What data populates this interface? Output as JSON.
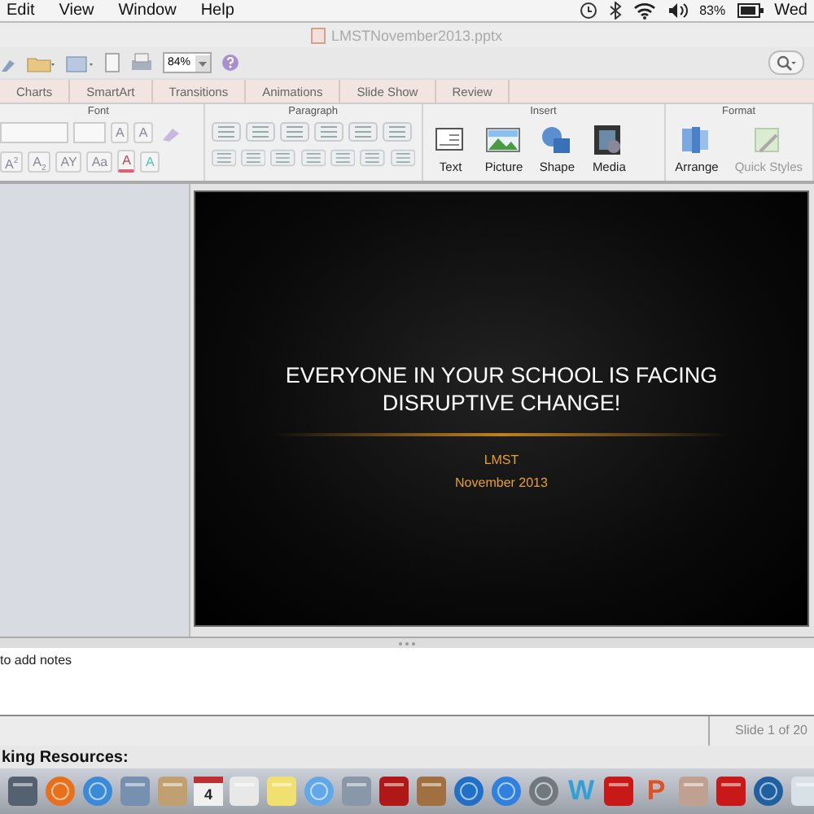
{
  "menu_bar": {
    "items": [
      "Edit",
      "View",
      "Window",
      "Help"
    ],
    "battery": "83%",
    "day": "Wed"
  },
  "window": {
    "title": "LMSTNovember2013.pptx"
  },
  "toolbar": {
    "zoom": "84%"
  },
  "ribbon_tabs": [
    {
      "label": "Charts",
      "selected": false
    },
    {
      "label": "SmartArt",
      "selected": false
    },
    {
      "label": "Transitions",
      "selected": false
    },
    {
      "label": "Animations",
      "selected": false
    },
    {
      "label": "Slide Show",
      "selected": false
    },
    {
      "label": "Review",
      "selected": false
    }
  ],
  "ribbon_groups": [
    {
      "kind": "font",
      "title": "Font",
      "top_buttons": [
        "A",
        "A"
      ],
      "bottom_buttons": [
        "A$^{2}$",
        "A$_{2}$",
        "AY",
        "Aa",
        "A",
        "A"
      ]
    },
    {
      "kind": "paragraph",
      "title": "Paragraph"
    },
    {
      "kind": "insert",
      "title": "Insert",
      "items": [
        {
          "kind": "text",
          "label": "Text"
        },
        {
          "kind": "picture",
          "label": "Picture"
        },
        {
          "kind": "shape",
          "label": "Shape"
        },
        {
          "kind": "media",
          "label": "Media"
        }
      ]
    },
    {
      "kind": "format",
      "title": "Format",
      "items": [
        {
          "kind": "arrange",
          "label": "Arrange"
        },
        {
          "kind": "styles",
          "label": "Quick Styles"
        }
      ]
    }
  ],
  "slide": {
    "title": "EVERYONE IN YOUR SCHOOL IS FACING DISRUPTIVE CHANGE!",
    "subtitle_lines": [
      "LMST",
      "November 2013"
    ]
  },
  "notes": {
    "placeholder": "to add notes"
  },
  "status_bar": {
    "slide_indicator": "Slide 1 of 20"
  },
  "background_text": "king Resources:",
  "dock": [
    {
      "kind": "app",
      "color": "#556070"
    },
    {
      "kind": "globe",
      "color": "#e8701a"
    },
    {
      "kind": "globe",
      "color": "#3a8ad8"
    },
    {
      "kind": "app",
      "color": "#7890b0"
    },
    {
      "kind": "app",
      "color": "#c0a070"
    },
    {
      "kind": "calendar",
      "label": "4",
      "color": "#f0f0f0"
    },
    {
      "kind": "app",
      "color": "#e8e8e8"
    },
    {
      "kind": "app",
      "color": "#f0e070"
    },
    {
      "kind": "globe",
      "color": "#60a8e8"
    },
    {
      "kind": "app",
      "color": "#8898a8"
    },
    {
      "kind": "app",
      "color": "#b01818"
    },
    {
      "kind": "app",
      "color": "#a07040"
    },
    {
      "kind": "globe",
      "color": "#2070c8"
    },
    {
      "kind": "globe",
      "color": "#3080e0"
    },
    {
      "kind": "globe",
      "color": "#707880"
    },
    {
      "kind": "letter",
      "label": "W",
      "color": "#30a0d8"
    },
    {
      "kind": "app",
      "color": "#c81818"
    },
    {
      "kind": "letter",
      "label": "P",
      "color": "#e05020"
    },
    {
      "kind": "app",
      "color": "#c0a090"
    },
    {
      "kind": "app",
      "color": "#c81818"
    },
    {
      "kind": "globe",
      "color": "#2060a0"
    },
    {
      "kind": "app",
      "color": "#d8e0e8"
    }
  ]
}
